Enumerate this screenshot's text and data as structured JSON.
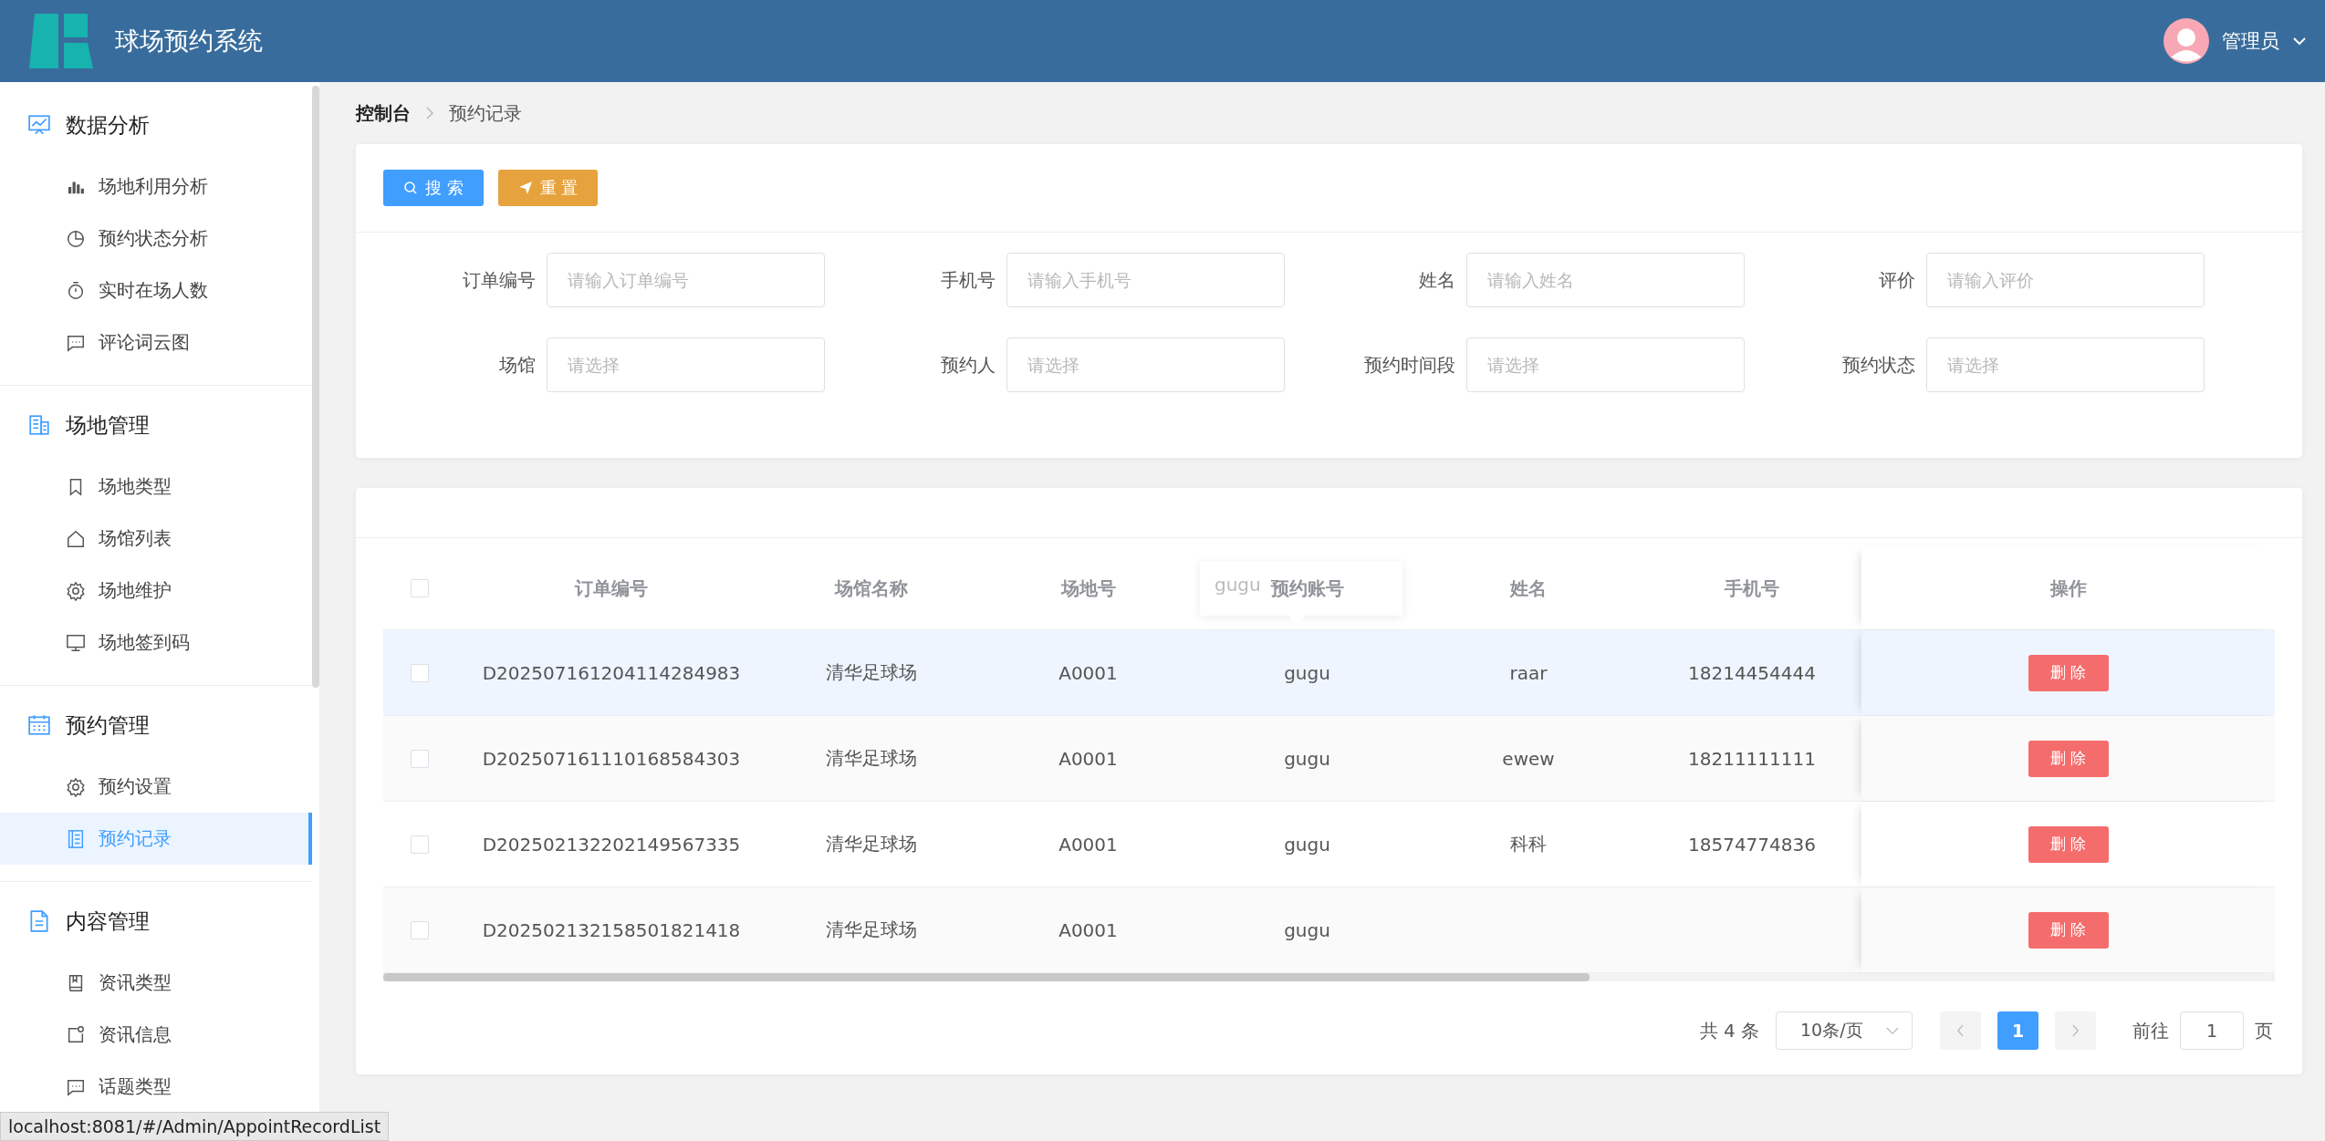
{
  "header": {
    "title": "球场预约系统",
    "user": "管理员"
  },
  "sidebar": {
    "groups": [
      {
        "title": "数据分析",
        "items": [
          {
            "label": "场地利用分析",
            "selected": false
          },
          {
            "label": "预约状态分析",
            "selected": false
          },
          {
            "label": "实时在场人数",
            "selected": false
          },
          {
            "label": "评论词云图",
            "selected": false
          }
        ]
      },
      {
        "title": "场地管理",
        "items": [
          {
            "label": "场地类型",
            "selected": false
          },
          {
            "label": "场馆列表",
            "selected": false
          },
          {
            "label": "场地维护",
            "selected": false
          },
          {
            "label": "场地签到码",
            "selected": false
          }
        ]
      },
      {
        "title": "预约管理",
        "items": [
          {
            "label": "预约设置",
            "selected": false
          },
          {
            "label": "预约记录",
            "selected": true
          }
        ]
      },
      {
        "title": "内容管理",
        "items": [
          {
            "label": "资讯类型",
            "selected": false
          },
          {
            "label": "资讯信息",
            "selected": false
          },
          {
            "label": "话题类型",
            "selected": false
          }
        ]
      }
    ]
  },
  "breadcrumb": [
    "控制台",
    "预约记录"
  ],
  "buttons": {
    "search": "搜 索",
    "reset": "重 置"
  },
  "filters": [
    {
      "label": "订单编号",
      "placeholder": "请输入订单编号"
    },
    {
      "label": "手机号",
      "placeholder": "请输入手机号"
    },
    {
      "label": "姓名",
      "placeholder": "请输入姓名"
    },
    {
      "label": "评价",
      "placeholder": "请输入评价"
    },
    {
      "label": "场馆",
      "placeholder": "请选择"
    },
    {
      "label": "预约人",
      "placeholder": "请选择"
    },
    {
      "label": "预约时间段",
      "placeholder": "请选择"
    },
    {
      "label": "预约状态",
      "placeholder": "请选择"
    }
  ],
  "table": {
    "all_checked": false,
    "columns": [
      "订单编号",
      "场馆名称",
      "场地号",
      "预约账号",
      "姓名",
      "手机号",
      "操作"
    ],
    "tooltip": "gugu",
    "rows": [
      {
        "checked": false,
        "hovered": true,
        "cells": [
          "D202507161204114284983",
          "清华足球场",
          "A0001",
          "gugu",
          "raar",
          "18214454444"
        ],
        "action": "删 除"
      },
      {
        "checked": false,
        "hovered": false,
        "cells": [
          "D202507161110168584303",
          "清华足球场",
          "A0001",
          "gugu",
          "ewew",
          "18211111111"
        ],
        "action": "删 除"
      },
      {
        "checked": false,
        "hovered": false,
        "cells": [
          "D202502132202149567335",
          "清华足球场",
          "A0001",
          "gugu",
          "科科",
          "18574774836"
        ],
        "action": "删 除"
      },
      {
        "checked": false,
        "hovered": false,
        "cells": [
          "D202502132158501821418",
          "清华足球场",
          "A0001",
          "gugu",
          "",
          ""
        ],
        "action": "删 除"
      }
    ]
  },
  "pagination": {
    "total": "共 4 条",
    "page_size": "10条/页",
    "pages": [
      {
        "label": "1",
        "selected": true
      }
    ],
    "goto_label": "前往",
    "goto_value": "1",
    "goto_suffix": "页"
  },
  "status_bar": "localhost:8081/#/Admin/AppointRecordList"
}
